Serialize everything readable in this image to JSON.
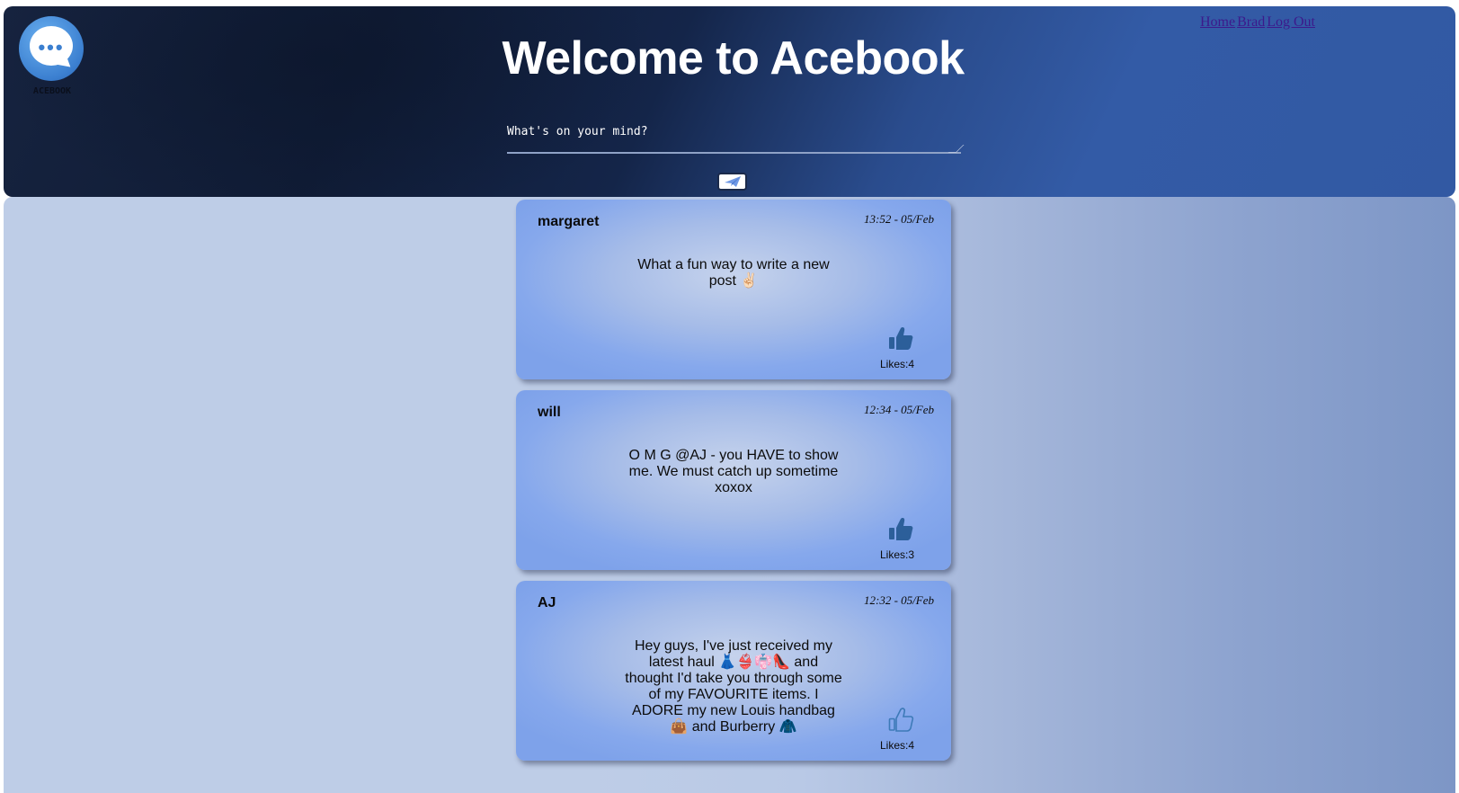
{
  "header": {
    "logo_text": "ACEBOOK",
    "title": "Welcome to Acebook",
    "nav": [
      "Home",
      "Brad",
      "Log Out"
    ],
    "composer_placeholder": "What's on your mind?",
    "send_icon": "paper-plane-icon"
  },
  "posts": [
    {
      "author": "margaret",
      "time": "13:52 - 05/Feb",
      "body": "What a fun way to write a new post ✌🏻",
      "likes_label": "Likes:4",
      "like_icon": "thumbs-up-filled-icon"
    },
    {
      "author": "will",
      "time": "12:34 - 05/Feb",
      "body": "O M G @AJ - you HAVE to show me. We must catch up sometime xoxox",
      "likes_label": "Likes:3",
      "like_icon": "thumbs-up-filled-icon"
    },
    {
      "author": "AJ",
      "time": "12:32 - 05/Feb",
      "body": "Hey guys, I've just received my latest haul 👗👙👘👠 and thought I'd take you through some of my FAVOURITE items. I ADORE my new Louis handbag 👜 and Burberry 🧥",
      "likes_label": "Likes:4",
      "like_icon": "thumbs-up-outline-icon"
    }
  ],
  "colors": {
    "header_dark": "#101c36",
    "header_blue": "#3259a3",
    "card_blue": "#86a8ec",
    "like_icon": "#2c5f9a"
  }
}
